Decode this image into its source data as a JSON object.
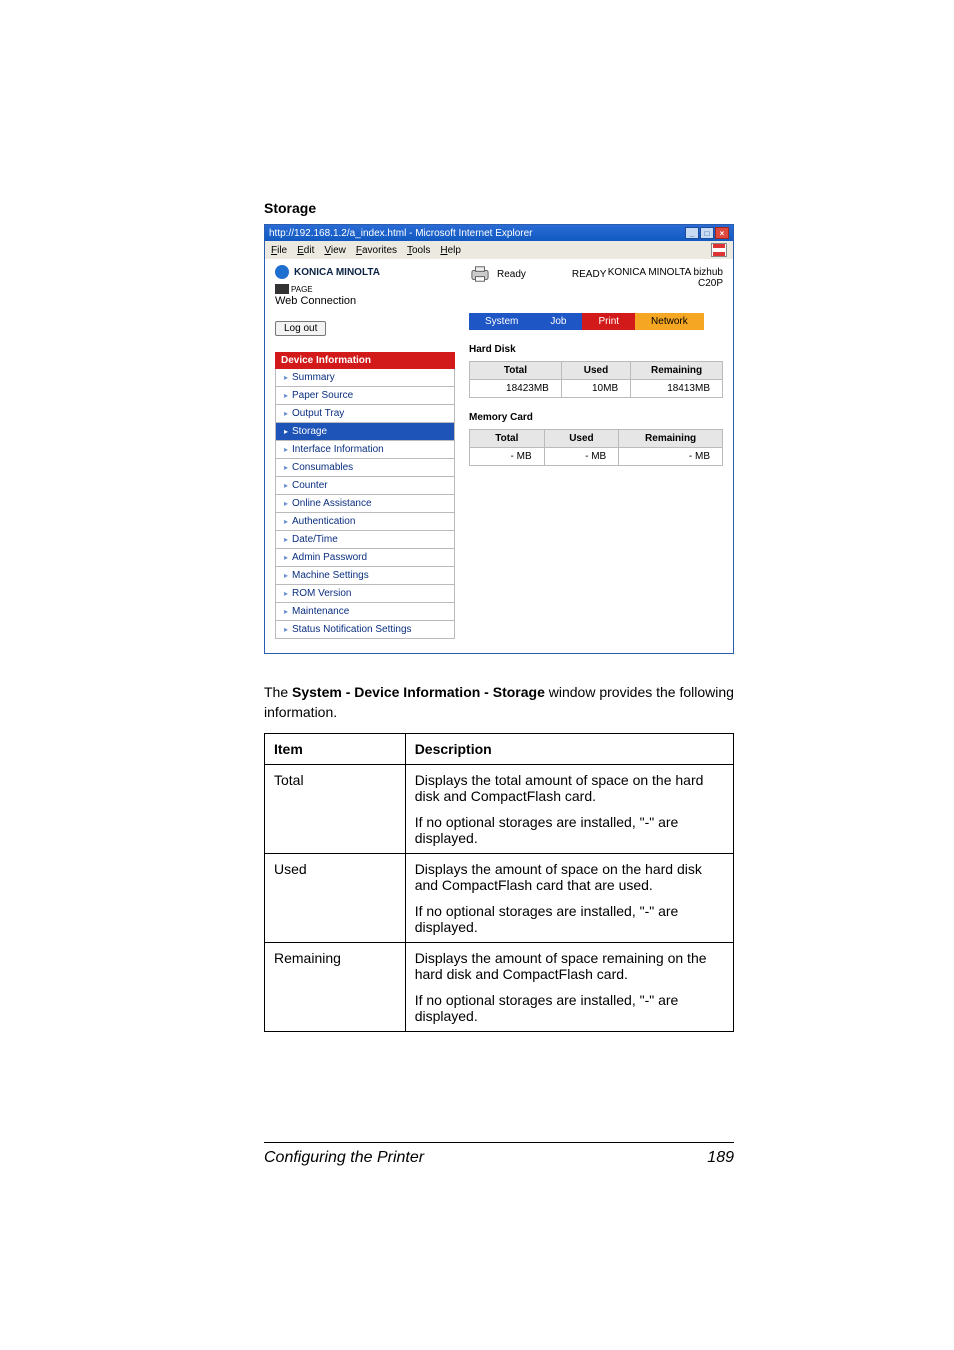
{
  "page": {
    "heading": "Storage",
    "description_prefix": "The ",
    "description_bold": "System - Device Information - Storage",
    "description_suffix": " window provides the following information.",
    "footer_left": "Configuring the Printer",
    "footer_right": "189"
  },
  "browser": {
    "title": "http://192.168.1.2/a_index.html - Microsoft Internet Explorer",
    "menus": [
      "File",
      "Edit",
      "View",
      "Favorites",
      "Tools",
      "Help"
    ]
  },
  "header": {
    "brand": "KONICA MINOLTA",
    "pagescope": "Web Connection",
    "logout": "Log out",
    "ready_label": "Ready",
    "ready_status": "READY",
    "model": "KONICA MINOLTA bizhub C20P"
  },
  "tabs": [
    "System",
    "Job",
    "Print",
    "Network"
  ],
  "sidebar": {
    "header": "Device Information",
    "items": [
      "Summary",
      "Paper Source",
      "Output Tray",
      "Storage",
      "Interface Information",
      "Consumables",
      "Counter",
      "Online Assistance",
      "Authentication",
      "Date/Time",
      "Admin Password",
      "Machine Settings",
      "ROM Version",
      "Maintenance",
      "Status Notification Settings"
    ],
    "selected": "Storage"
  },
  "panels": {
    "hard_disk": {
      "title": "Hard Disk",
      "cols": [
        "Total",
        "Used",
        "Remaining"
      ],
      "values": [
        "18423MB",
        "10MB",
        "18413MB"
      ]
    },
    "memory_card": {
      "title": "Memory Card",
      "cols": [
        "Total",
        "Used",
        "Remaining"
      ],
      "values": [
        "- MB",
        "- MB",
        "- MB"
      ]
    }
  },
  "info_table": {
    "headers": [
      "Item",
      "Description"
    ],
    "rows": [
      {
        "item": "Total",
        "desc": [
          "Displays the total amount of space on the hard disk and CompactFlash card.",
          "If no optional storages are installed, \"-\" are displayed."
        ]
      },
      {
        "item": "Used",
        "desc": [
          "Displays the amount of space on the hard disk and CompactFlash card that are used.",
          "If no optional storages are installed, \"-\" are displayed."
        ]
      },
      {
        "item": "Remaining",
        "desc": [
          "Displays the amount of space remaining on the hard disk and CompactFlash card.",
          "If no optional storages are installed, \"-\" are displayed."
        ]
      }
    ]
  }
}
